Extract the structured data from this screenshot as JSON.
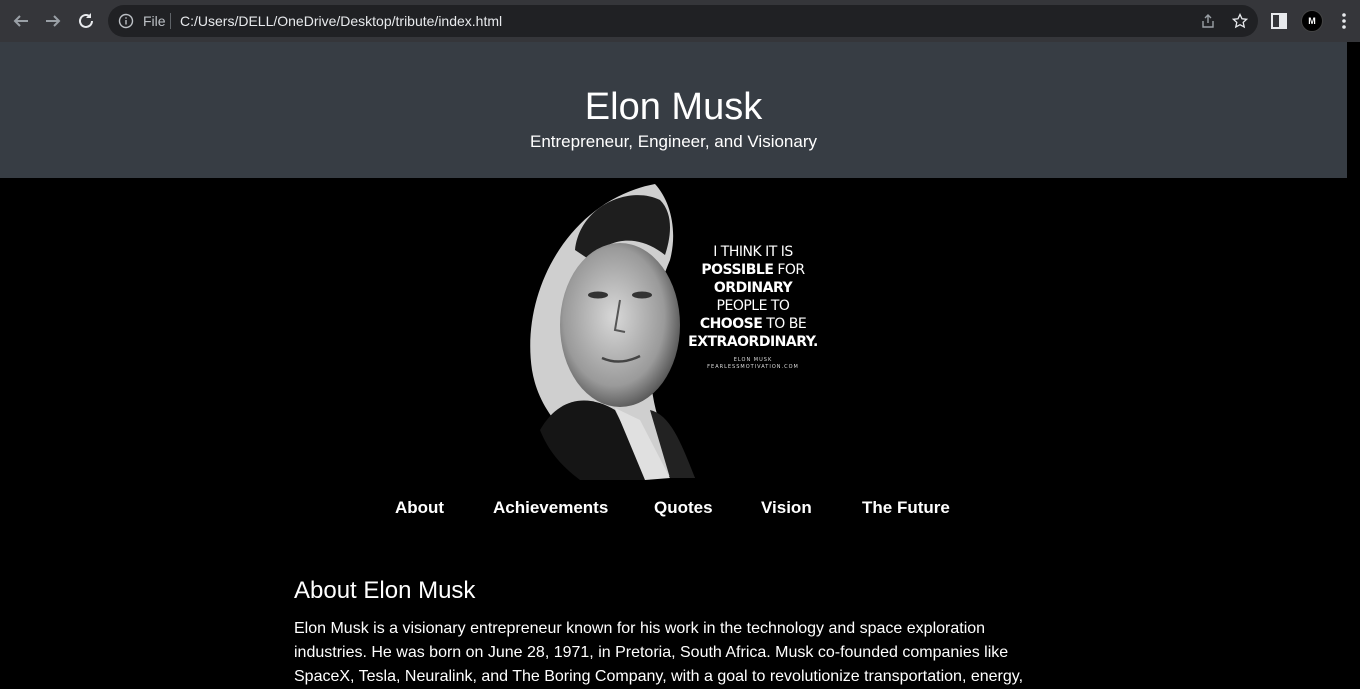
{
  "browser": {
    "file_label": "File",
    "url": "C:/Users/DELL/OneDrive/Desktop/tribute/index.html"
  },
  "header": {
    "title": "Elon Musk",
    "subtitle": "Entrepreneur, Engineer, and Visionary"
  },
  "hero": {
    "quote": {
      "line1": "I THINK IT IS",
      "line2_bold": "POSSIBLE",
      "line2_rest": " FOR",
      "line3_bold": "ORDINARY",
      "line4": "PEOPLE TO",
      "line5_bold": "CHOOSE",
      "line5_rest": " TO BE",
      "line6_bold": "EXTRAORDINARY.",
      "attribution": "ELON MUSK",
      "source": "FEARLESSMOTIVATION.COM"
    }
  },
  "nav": {
    "items": [
      "About",
      "Achievements",
      "Quotes",
      "Vision",
      "The Future"
    ]
  },
  "about": {
    "heading": "About Elon Musk",
    "text": "Elon Musk is a visionary entrepreneur known for his work in the technology and space exploration industries. He was born on June 28, 1971, in Pretoria, South Africa. Musk co-founded companies like SpaceX, Tesla, Neuralink, and The Boring Company, with a goal to revolutionize transportation, energy,"
  }
}
